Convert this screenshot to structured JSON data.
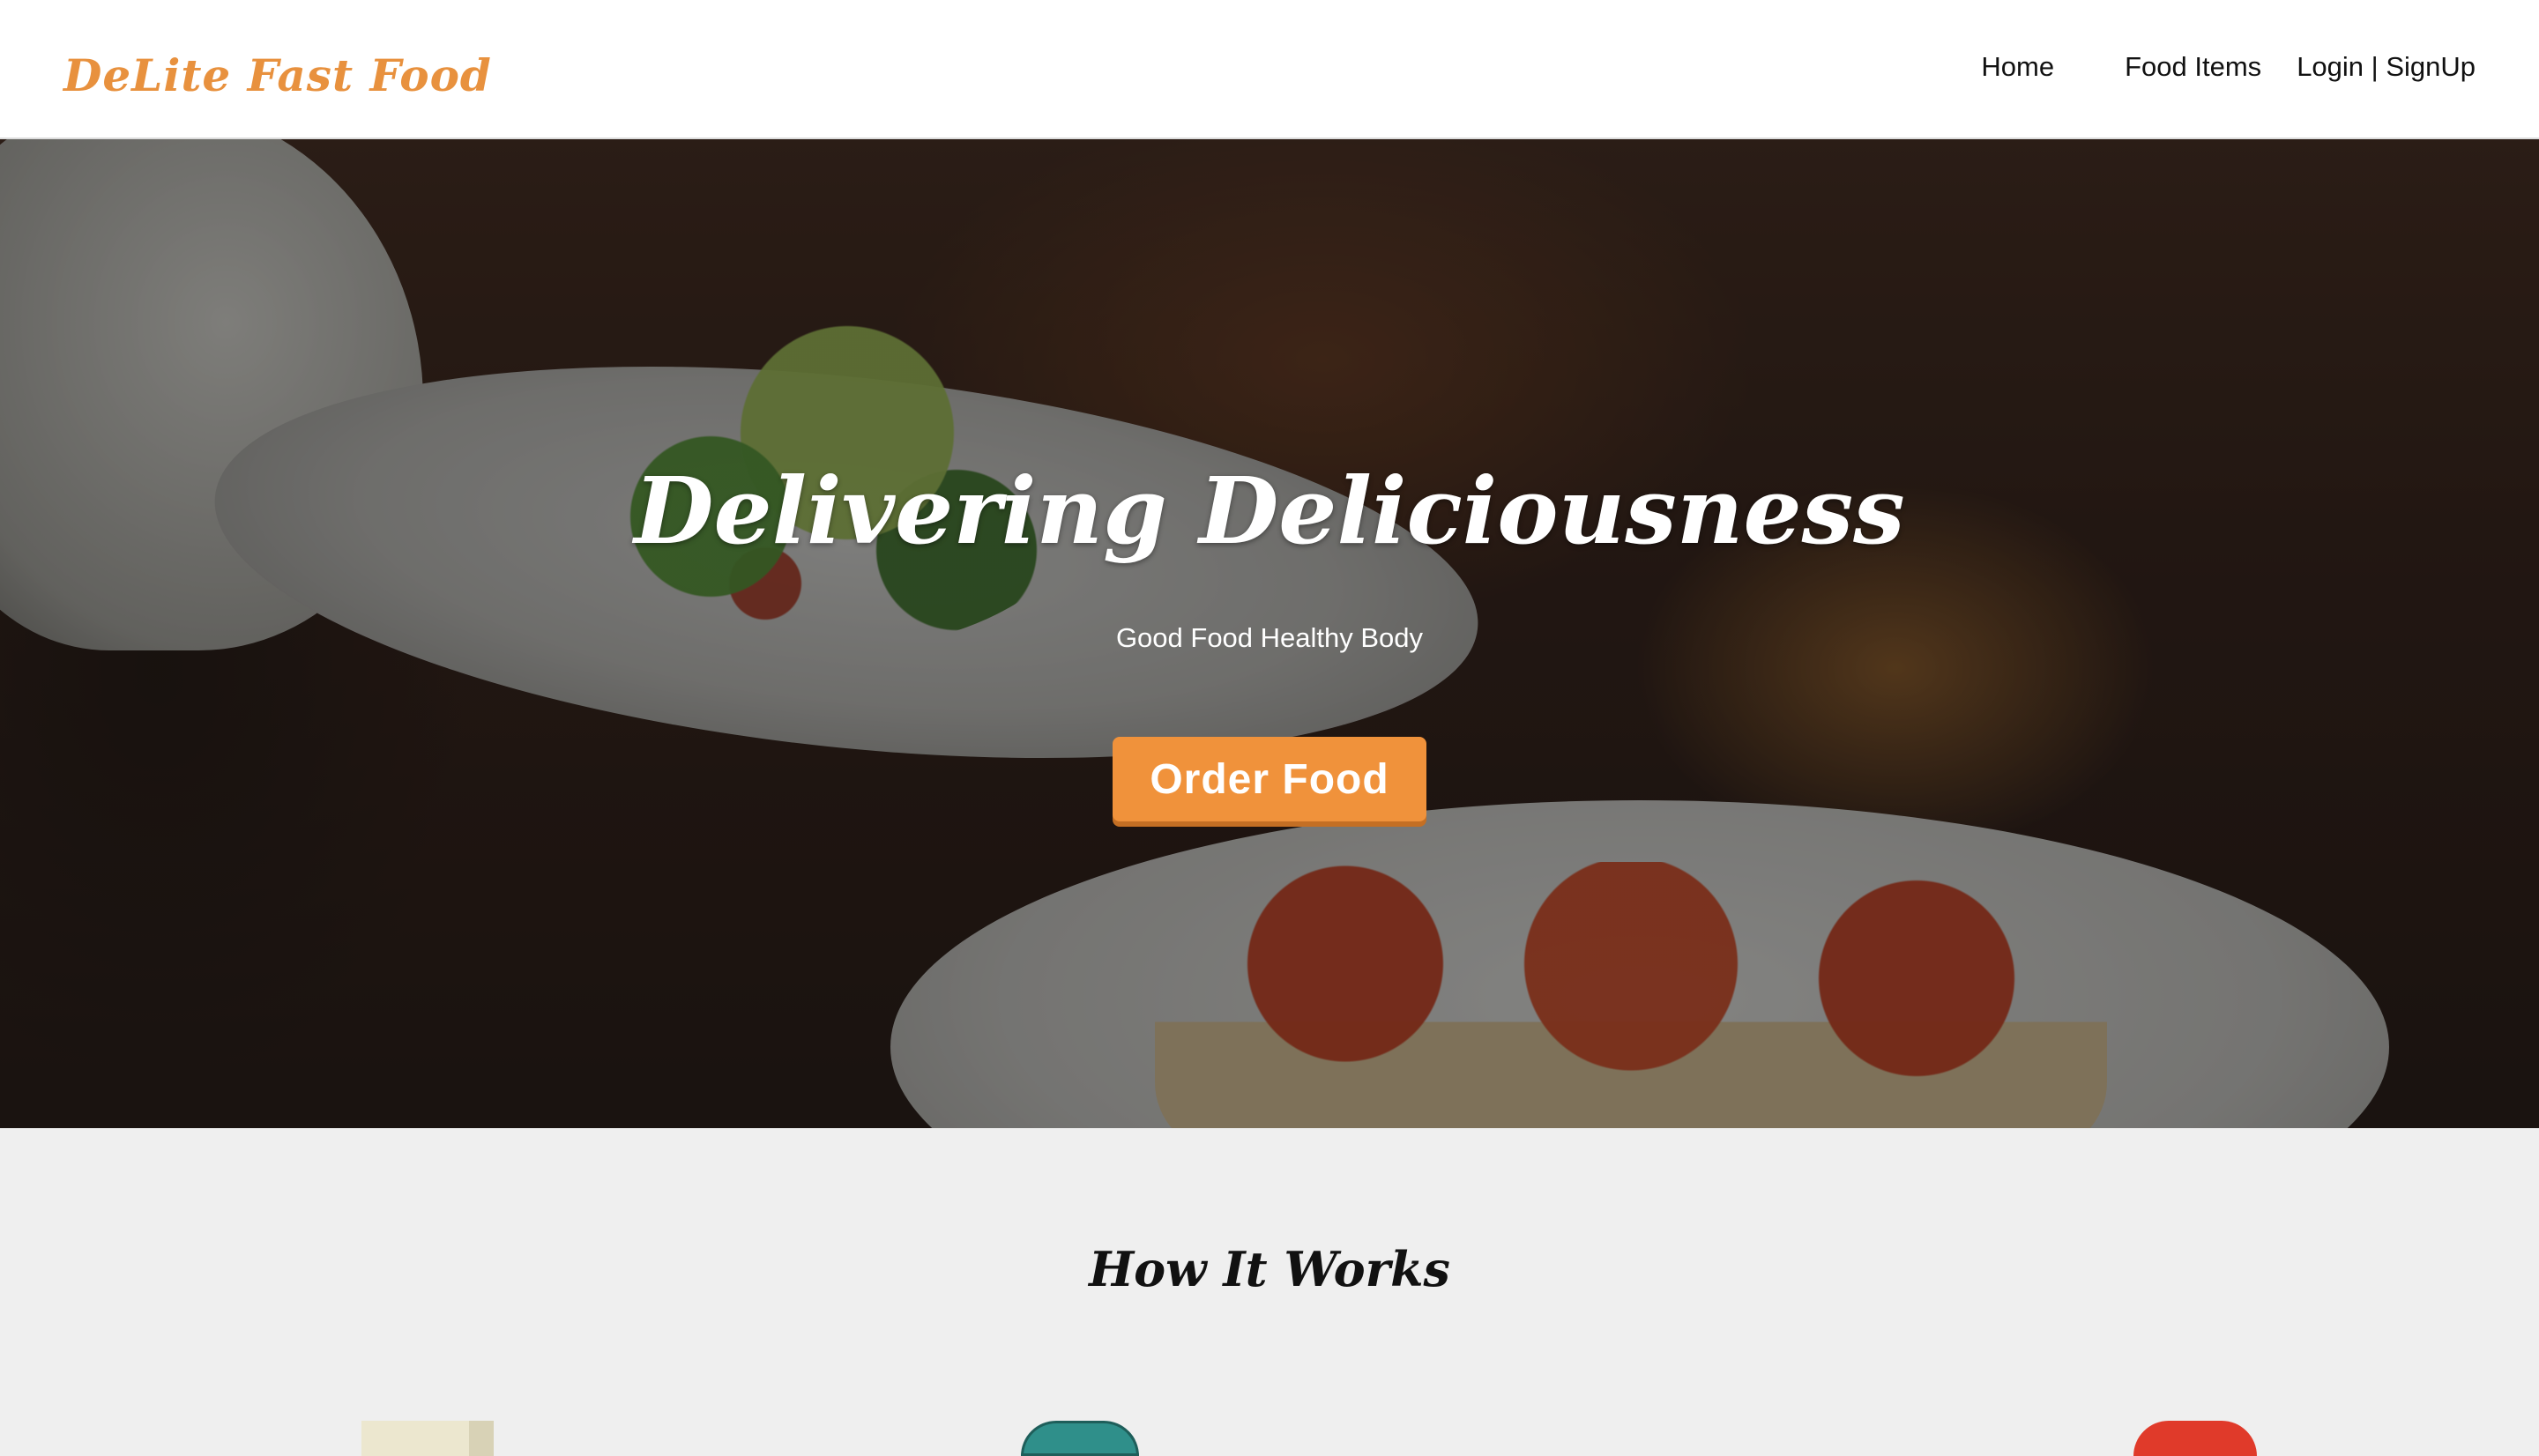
{
  "navbar": {
    "brand": "DeLite Fast Food",
    "links": {
      "home": "Home",
      "food_items": "Food Items",
      "login_signup": "Login | SignUp"
    }
  },
  "hero": {
    "title": "Delivering Deliciousness",
    "subtitle": "Good Food Healthy Body",
    "cta_label": "Order Food"
  },
  "how_it_works": {
    "title": "How It Works",
    "step_icons": [
      "order-box-icon",
      "food-cover-icon",
      "delivery-icon"
    ]
  },
  "colors": {
    "brand": "#e8913e",
    "button": "#f0923b",
    "page_bg": "#efefef"
  }
}
